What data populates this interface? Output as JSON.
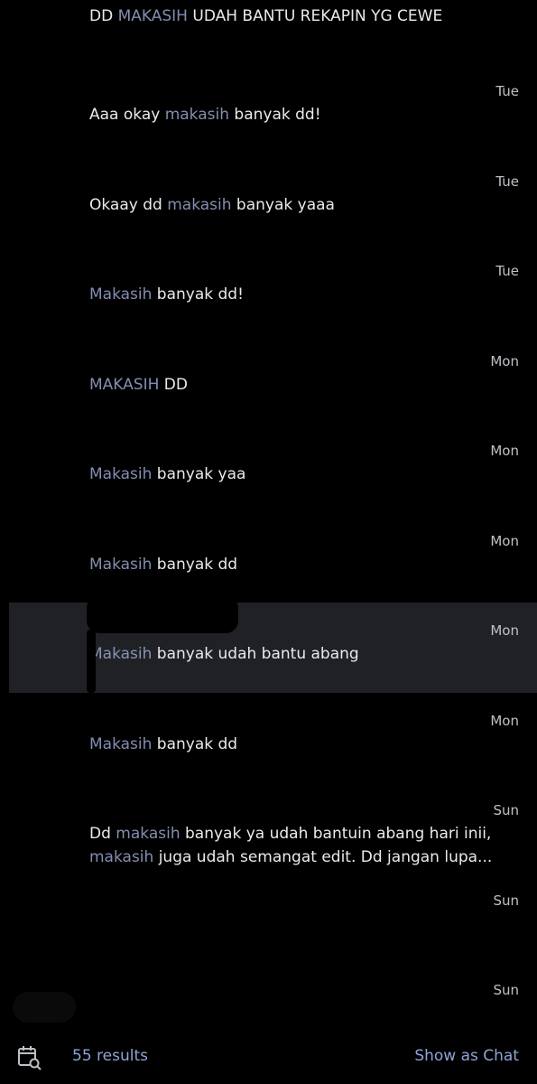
{
  "top_result": {
    "prefix": "DD ",
    "highlight": "MAKASIH",
    "suffix": " UDAH BANTU REKAPIN YG CEWE"
  },
  "results": [
    {
      "time": "Tue",
      "lines": [
        [
          {
            "t": "Aaa okay ",
            "h": false
          },
          {
            "t": "makasih",
            "h": true
          },
          {
            "t": " banyak dd!",
            "h": false
          }
        ]
      ]
    },
    {
      "time": "Tue",
      "lines": [
        [
          {
            "t": "Okaay dd ",
            "h": false
          },
          {
            "t": "makasih",
            "h": true
          },
          {
            "t": " banyak yaaa",
            "h": false
          }
        ]
      ]
    },
    {
      "time": "Tue",
      "lines": [
        [
          {
            "t": "Makasih",
            "h": true
          },
          {
            "t": " banyak dd!",
            "h": false
          }
        ]
      ]
    },
    {
      "time": "Mon",
      "lines": [
        [
          {
            "t": "MAKASIH",
            "h": true
          },
          {
            "t": " DD",
            "h": false
          }
        ]
      ]
    },
    {
      "time": "Mon",
      "lines": [
        [
          {
            "t": "Makasih",
            "h": true
          },
          {
            "t": " banyak yaa",
            "h": false
          }
        ]
      ]
    },
    {
      "time": "Mon",
      "lines": [
        [
          {
            "t": "Makasih",
            "h": true
          },
          {
            "t": " banyak dd",
            "h": false
          }
        ]
      ]
    },
    {
      "time": "Mon",
      "highlighted": true,
      "lines": [
        [
          {
            "t": "Makasih",
            "h": true
          },
          {
            "t": " banyak udah bantu abang",
            "h": false
          }
        ]
      ]
    },
    {
      "time": "Mon",
      "lines": [
        [
          {
            "t": "Makasih",
            "h": true
          },
          {
            "t": " banyak dd",
            "h": false
          }
        ]
      ]
    },
    {
      "time": "Sun",
      "lines": [
        [
          {
            "t": "Dd ",
            "h": false
          },
          {
            "t": "makasih",
            "h": true
          },
          {
            "t": " banyak ya udah bantuin abang hari inii,",
            "h": false
          }
        ],
        [
          {
            "t": "makasih",
            "h": true
          },
          {
            "t": " juga udah semangat edit. Dd jangan lupa...",
            "h": false
          }
        ]
      ]
    },
    {
      "time": "Sun",
      "lines": []
    },
    {
      "time": "Sun",
      "lines": []
    }
  ],
  "footer": {
    "results_count": "55 results",
    "show_as_chat": "Show as Chat",
    "icon": "calendar-search-icon"
  },
  "colors": {
    "background": "#000000",
    "highlight_row": "#202124",
    "text": "#e8eaed",
    "keyword": "#9aa6cf",
    "link": "#8fa3d6"
  }
}
